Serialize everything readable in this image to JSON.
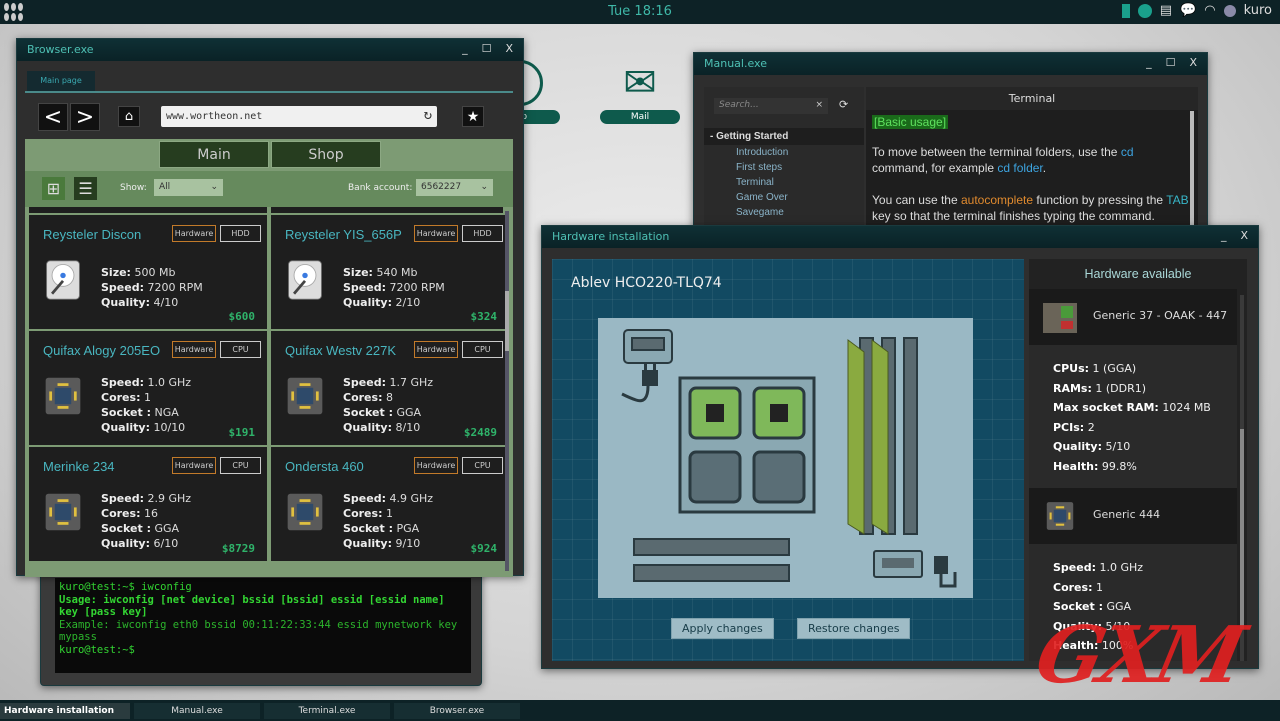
{
  "topbar": {
    "time": "Tue 18:16",
    "user": "kuro",
    "icons": [
      "grid-menu-icon",
      "battery-icon",
      "status-circle-icon",
      "clipboard-icon",
      "chat-icon",
      "wifi-icon",
      "user-avatar-icon"
    ]
  },
  "desktop": {
    "icons": [
      {
        "label": "...p"
      },
      {
        "label": "Mail"
      }
    ]
  },
  "browser": {
    "title": "Browser.exe",
    "tab": "Main page",
    "url": "www.wortheon.net",
    "site_tabs": [
      "Main",
      "Shop"
    ],
    "show_label": "Show:",
    "show_value": "All",
    "bank_label": "Bank account:",
    "bank_value": "6562227",
    "products": [
      {
        "name": "Reysteler Discon",
        "tag": "Hardware",
        "type": "HDD",
        "specs": [
          [
            "Size:",
            "500 Mb"
          ],
          [
            "Speed:",
            "7200 RPM"
          ],
          [
            "Quality:",
            "4/10"
          ]
        ],
        "price": "$600"
      },
      {
        "name": "Reysteler YIS_656P",
        "tag": "Hardware",
        "type": "HDD",
        "specs": [
          [
            "Size:",
            "540 Mb"
          ],
          [
            "Speed:",
            "7200 RPM"
          ],
          [
            "Quality:",
            "2/10"
          ]
        ],
        "price": "$324"
      },
      {
        "name": "Quifax Alogy 205EO",
        "tag": "Hardware",
        "type": "CPU",
        "specs": [
          [
            "Speed:",
            "1.0 GHz"
          ],
          [
            "Cores:",
            "1"
          ],
          [
            "Socket :",
            "NGA"
          ],
          [
            "Quality:",
            "10/10"
          ]
        ],
        "price": "$191"
      },
      {
        "name": "Quifax Westv 227K",
        "tag": "Hardware",
        "type": "CPU",
        "specs": [
          [
            "Speed:",
            "1.7 GHz"
          ],
          [
            "Cores:",
            "8"
          ],
          [
            "Socket :",
            "GGA"
          ],
          [
            "Quality:",
            "8/10"
          ]
        ],
        "price": "$2489"
      },
      {
        "name": "Merinke 234",
        "tag": "Hardware",
        "type": "CPU",
        "specs": [
          [
            "Speed:",
            "2.9 GHz"
          ],
          [
            "Cores:",
            "16"
          ],
          [
            "Socket :",
            "GGA"
          ],
          [
            "Quality:",
            "6/10"
          ]
        ],
        "price": "$8729"
      },
      {
        "name": "Ondersta 460",
        "tag": "Hardware",
        "type": "CPU",
        "specs": [
          [
            "Speed:",
            "4.9 GHz"
          ],
          [
            "Cores:",
            "1"
          ],
          [
            "Socket :",
            "PGA"
          ],
          [
            "Quality:",
            "9/10"
          ]
        ],
        "price": "$924"
      }
    ]
  },
  "terminal": {
    "lines": [
      "kuro@test:~$ iwconfig",
      "Usage: iwconfig [net device] bssid [bssid] essid [essid name] key [pass key]",
      "Example: iwconfig eth0 bssid 00:11:22:33:44 essid mynetwork key mypass",
      "kuro@test:~$"
    ]
  },
  "manual": {
    "title": "Manual.exe",
    "search_placeholder": "Search...",
    "section": "Getting Started",
    "items": [
      "Introduction",
      "First steps",
      "Terminal",
      "Game Over",
      "Savegame"
    ],
    "heading": "Terminal",
    "badge": "[Basic usage]",
    "p1": [
      "To move between the terminal folders, use the ",
      "cd",
      " command, for example ",
      "cd folder",
      "."
    ],
    "p2": [
      "You can use the ",
      "autocomplete",
      " function by pressing the ",
      "TAB",
      " key so that the terminal finishes typing the command."
    ]
  },
  "hardware": {
    "title": "Hardware installation",
    "board_name": "Ablev HCO220-TLQ74",
    "apply": "Apply changes",
    "restore": "Restore changes",
    "available_title": "Hardware available",
    "items": [
      {
        "name": "Generic 37 - OAAK - 447",
        "specs": [
          [
            "CPUs:",
            "1 (GGA)"
          ],
          [
            "RAMs:",
            "1 (DDR1)"
          ],
          [
            "Max socket RAM:",
            "1024 MB"
          ],
          [
            "PCIs:",
            "2"
          ],
          [
            "Quality:",
            "5/10"
          ],
          [
            "Health:",
            "99.8%"
          ]
        ]
      },
      {
        "name": "Generic 444",
        "specs": [
          [
            "Speed:",
            "1.0 GHz"
          ],
          [
            "Cores:",
            "1"
          ],
          [
            "Socket :",
            "GGA"
          ],
          [
            "Quality:",
            "5/10"
          ],
          [
            "Health:",
            "100%"
          ]
        ]
      }
    ]
  },
  "taskbar": [
    "Hardware installation",
    "Manual.exe",
    "Terminal.exe",
    "Browser.exe"
  ],
  "logo": "GXM",
  "colors": {
    "accent": "#3fb8a8",
    "price": "#2fb36a",
    "title": "#49b6c0",
    "tag": "#c27a2a",
    "logo": "#e02020"
  }
}
